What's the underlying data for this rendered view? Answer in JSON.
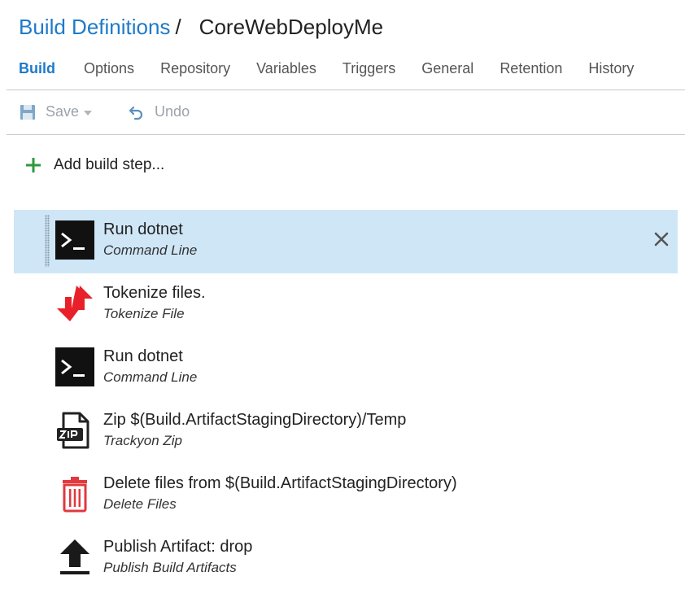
{
  "breadcrumb": {
    "parent": "Build Definitions",
    "separator": "/",
    "current": "CoreWebDeployMe"
  },
  "tabs": [
    {
      "label": "Build",
      "active": true
    },
    {
      "label": "Options"
    },
    {
      "label": "Repository"
    },
    {
      "label": "Variables"
    },
    {
      "label": "Triggers"
    },
    {
      "label": "General"
    },
    {
      "label": "Retention"
    },
    {
      "label": "History"
    }
  ],
  "toolbar": {
    "save_label": "Save",
    "undo_label": "Undo"
  },
  "add_step_label": "Add build step...",
  "steps": [
    {
      "title": "Run dotnet",
      "subtitle": "Command Line",
      "icon": "command-line-icon",
      "selected": true
    },
    {
      "title": "Tokenize files.",
      "subtitle": "Tokenize File",
      "icon": "tokenize-arrows-icon"
    },
    {
      "title": "Run dotnet",
      "subtitle": "Command Line",
      "icon": "command-line-icon"
    },
    {
      "title": "Zip $(Build.ArtifactStagingDirectory)/Temp",
      "subtitle": "Trackyon Zip",
      "icon": "zip-file-icon"
    },
    {
      "title": "Delete files from $(Build.ArtifactStagingDirectory)",
      "subtitle": "Delete Files",
      "icon": "trash-icon"
    },
    {
      "title": "Publish Artifact: drop",
      "subtitle": "Publish Build Artifacts",
      "icon": "upload-icon"
    }
  ],
  "colors": {
    "accent": "#1e7ac9",
    "selected_row": "#cfe6f7",
    "add_green": "#2e9a3e",
    "delete_red": "#e0383e",
    "tokenize_red": "#e8202a"
  }
}
